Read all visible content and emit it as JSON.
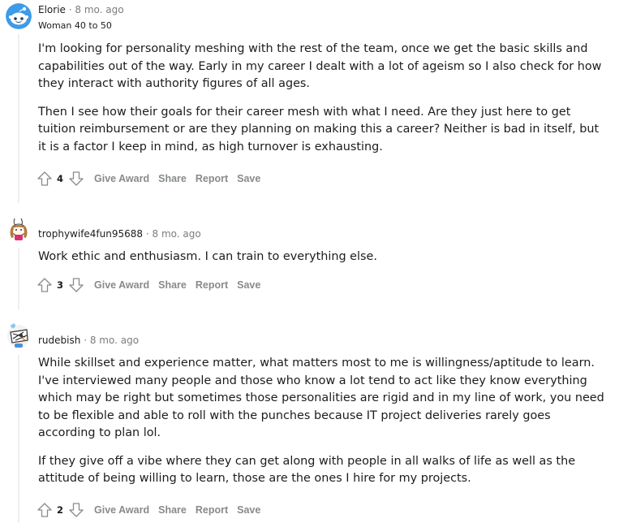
{
  "comments": [
    {
      "author": "Elorie",
      "separator": "·",
      "time": "8 mo. ago",
      "flair": "Woman 40 to 50",
      "avatar": "snoo-blue-avatar",
      "paragraphs": [
        "I'm looking for personality meshing with the rest of the team, once we get the basic skills and capabilities out of the way. Early in my career I dealt with a lot of ageism so I also check for how they interact with authority figures of all ages.",
        "Then I see how their goals for their career mesh with what I need. Are they just here to get tuition reimbursement or are they planning on making this a career? Neither is bad in itself, but it is a factor I keep in mind, as high turnover is exhausting."
      ],
      "score": "4",
      "actions": [
        "Give Award",
        "Share",
        "Report",
        "Save"
      ]
    },
    {
      "author": "trophywife4fun95688",
      "separator": "·",
      "time": "8 mo. ago",
      "avatar": "snoo-bunny-avatar",
      "paragraphs": [
        "Work ethic and enthusiasm. I can train to everything else."
      ],
      "score": "3",
      "actions": [
        "Give Award",
        "Share",
        "Report",
        "Save"
      ]
    },
    {
      "author": "rudebish",
      "separator": "·",
      "time": "8 mo. ago",
      "avatar": "snoo-sketch-avatar",
      "paragraphs": [
        "While skillset and experience matter, what matters most to me is willingness/aptitude to learn. I've interviewed many people and those who know a lot tend to act like they know everything which may be right but sometimes those personalities are rigid and in my line of work, you need to be flexible and able to roll with the punches because IT project deliveries rarely goes according to plan lol.",
        "If they give off a vibe where they can get along with people in all walks of life as well as the attitude of being willing to learn, those are the ones I hire for my projects."
      ],
      "score": "2",
      "actions": [
        "Give Award",
        "Share",
        "Report",
        "Save"
      ]
    }
  ],
  "icons": {
    "upvote": "arrow-up-outline",
    "downvote": "arrow-down-outline"
  },
  "colors": {
    "text": "#1c1c1c",
    "muted": "#7c7c7c",
    "action": "#878a8c",
    "thread_line": "#edeff1",
    "snoo_blue": "#3d9be9"
  }
}
